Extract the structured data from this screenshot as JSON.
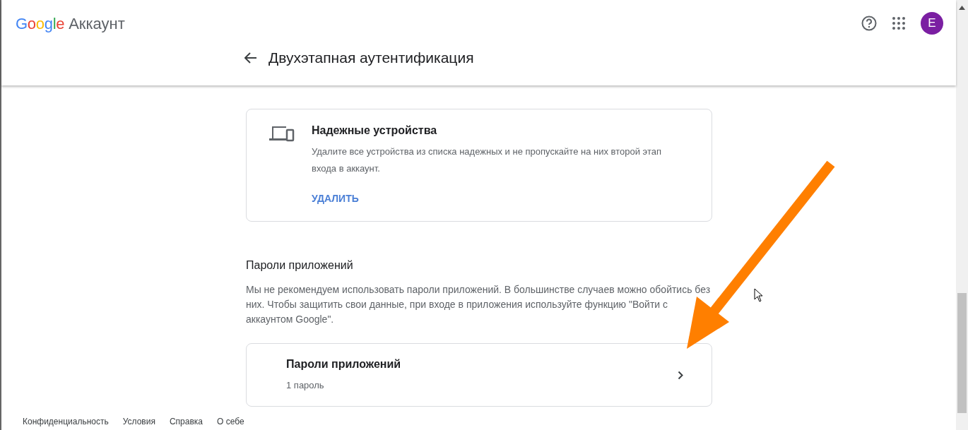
{
  "header": {
    "logo": "Google",
    "product": "Аккаунт",
    "avatar_letter": "E"
  },
  "page_title": "Двухэтапная аутентификация",
  "trusted_devices": {
    "title": "Надежные устройства",
    "description": "Удалите все устройства из списка надежных и не пропускайте на них второй этап входа в аккаунт.",
    "action": "УДАЛИТЬ"
  },
  "app_passwords": {
    "heading": "Пароли приложений",
    "description": "Мы не рекомендуем использовать пароли приложений. В большинстве случаев можно обойтись без них. Чтобы защитить свои данные, при входе в приложения используйте функцию \"Войти с аккаунтом Google\".",
    "card": {
      "title": "Пароли приложений",
      "subtitle": "1 пароль"
    }
  },
  "footer_links": [
    "Конфиденциальность",
    "Условия",
    "Справка",
    "О себе"
  ],
  "annotation": {
    "kind": "arrow",
    "color": "#ff7f00"
  }
}
